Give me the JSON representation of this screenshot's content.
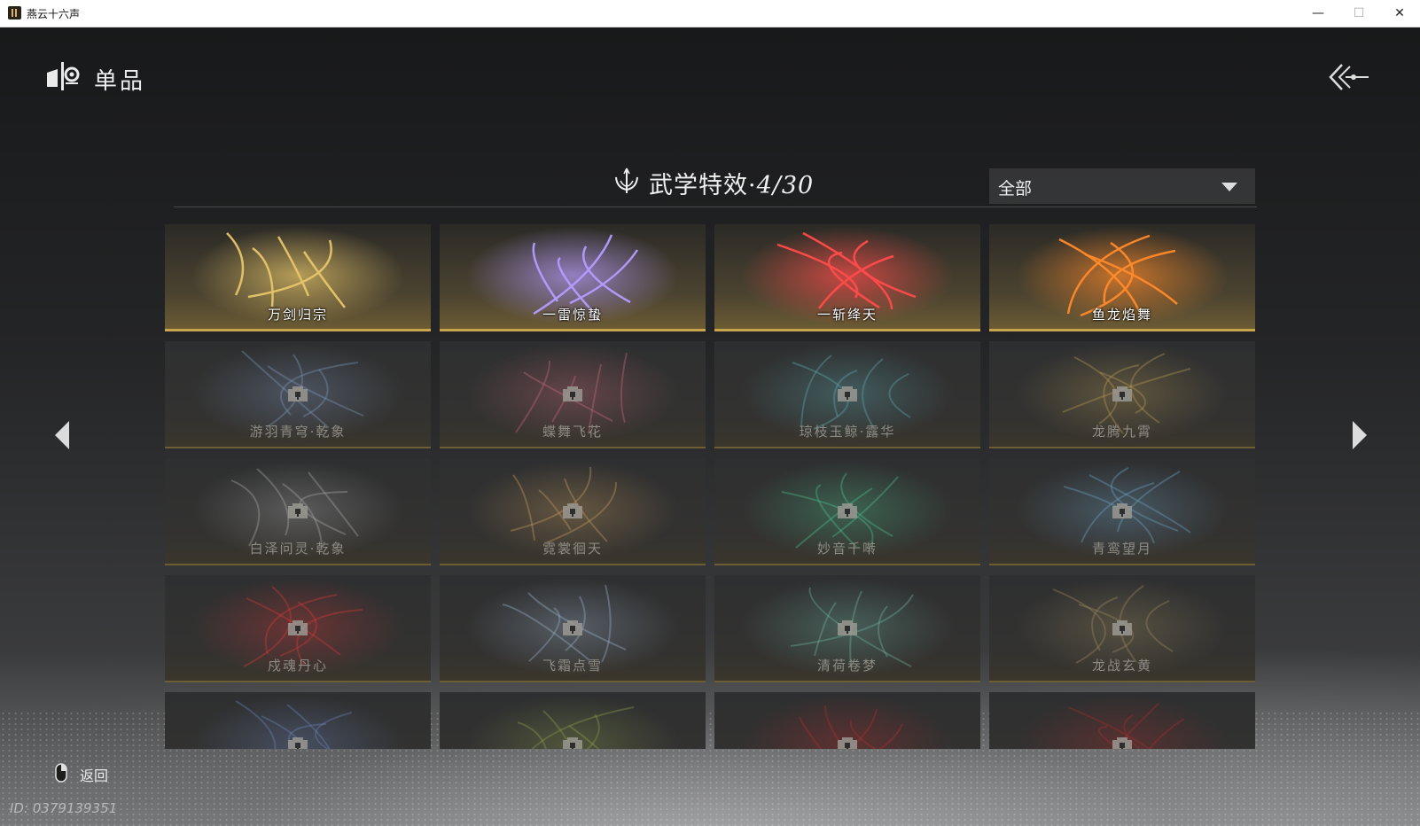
{
  "window": {
    "title": "燕云十六声",
    "controls": {
      "minimize": "—",
      "maximize": "☐",
      "close": "✕"
    }
  },
  "header": {
    "title": "单品",
    "icon": "item-shop-icon",
    "back_icon": "back-arrow-icon"
  },
  "section": {
    "title": "武学特效·",
    "count": "4/30",
    "icon": "martial-lotus-icon"
  },
  "filter": {
    "selected": "全部",
    "icon": "caret-down-icon"
  },
  "effects": [
    {
      "name": "万剑归宗",
      "unlocked": true,
      "theme": "#e6c56a"
    },
    {
      "name": "一雷惊蛰",
      "unlocked": true,
      "theme": "#b49cff"
    },
    {
      "name": "一斩绛天",
      "unlocked": true,
      "theme": "#ff4b4b"
    },
    {
      "name": "鱼龙焰舞",
      "unlocked": true,
      "theme": "#ff8a2a"
    },
    {
      "name": "游羽青穹·乾象",
      "unlocked": false,
      "theme": "#7d95b8"
    },
    {
      "name": "蝶舞飞花",
      "unlocked": false,
      "theme": "#c46a78"
    },
    {
      "name": "琼枝玉鲸·露华",
      "unlocked": false,
      "theme": "#5fa9b0"
    },
    {
      "name": "龙腾九霄",
      "unlocked": false,
      "theme": "#b59a55"
    },
    {
      "name": "白泽问灵·乾象",
      "unlocked": false,
      "theme": "#a8a8a8"
    },
    {
      "name": "霓裳徊天",
      "unlocked": false,
      "theme": "#c59b5e"
    },
    {
      "name": "妙音千啭",
      "unlocked": false,
      "theme": "#4fbf8c"
    },
    {
      "name": "青鸾望月",
      "unlocked": false,
      "theme": "#6fa3c2"
    },
    {
      "name": "戍魂丹心",
      "unlocked": false,
      "theme": "#d53a3a"
    },
    {
      "name": "飞霜点雪",
      "unlocked": false,
      "theme": "#9ab0c8"
    },
    {
      "name": "清荷卷梦",
      "unlocked": false,
      "theme": "#6fb3a0"
    },
    {
      "name": "龙战玄黄",
      "unlocked": false,
      "theme": "#9a8a5e"
    },
    {
      "name": "",
      "unlocked": false,
      "theme": "#6b84b8"
    },
    {
      "name": "",
      "unlocked": false,
      "theme": "#8a9a4e"
    },
    {
      "name": "",
      "unlocked": false,
      "theme": "#b03030"
    },
    {
      "name": "",
      "unlocked": false,
      "theme": "#a03030"
    }
  ],
  "navigation": {
    "prev_icon": "arrow-left-icon",
    "next_icon": "arrow-right-icon"
  },
  "footer": {
    "back_label": "返回",
    "mouse_icon": "mouse-right-click-icon",
    "user_id": "ID: 0379139351"
  }
}
